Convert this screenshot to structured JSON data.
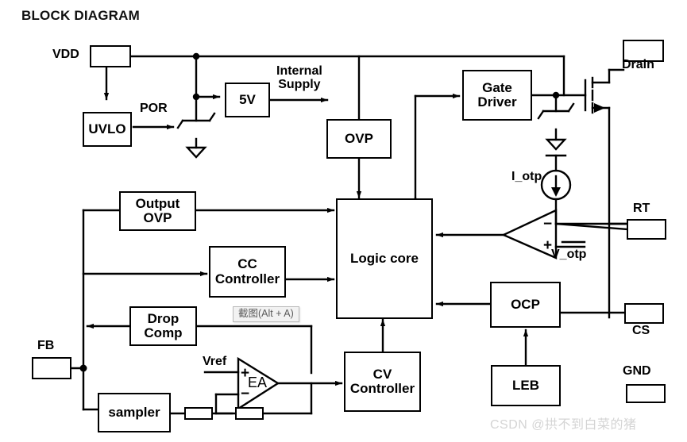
{
  "title": "BLOCK DIAGRAM",
  "blocks": [
    {
      "id": "uvlo",
      "label": "UVLO"
    },
    {
      "id": "reg5v",
      "label": "5V"
    },
    {
      "id": "ovp",
      "label": "OVP"
    },
    {
      "id": "gate_driver",
      "label": "Gate\nDriver"
    },
    {
      "id": "output_ovp",
      "label": "Output\nOVP"
    },
    {
      "id": "cc_ctrl",
      "label": "CC\nController"
    },
    {
      "id": "drop_comp",
      "label": "Drop\nComp"
    },
    {
      "id": "logic_core",
      "label": "Logic core"
    },
    {
      "id": "cv_ctrl",
      "label": "CV\nController"
    },
    {
      "id": "ocp",
      "label": "OCP"
    },
    {
      "id": "leb",
      "label": "LEB"
    },
    {
      "id": "sampler",
      "label": "sampler"
    }
  ],
  "pins": [
    {
      "id": "vdd",
      "label": "VDD"
    },
    {
      "id": "drain",
      "label": "Drain"
    },
    {
      "id": "rt",
      "label": "RT"
    },
    {
      "id": "cs",
      "label": "CS"
    },
    {
      "id": "gnd",
      "label": "GND"
    },
    {
      "id": "fb",
      "label": "FB"
    }
  ],
  "signals": [
    {
      "id": "por",
      "label": "POR"
    },
    {
      "id": "internal_supply",
      "label": "Internal\nSupply"
    },
    {
      "id": "i_otp",
      "label": "I_otp"
    },
    {
      "id": "v_otp",
      "label": "V_otp"
    },
    {
      "id": "vref",
      "label": "Vref"
    },
    {
      "id": "ea",
      "label": "EA"
    }
  ],
  "amplifier_signs": {
    "ea_plus": "+",
    "ea_minus": "−",
    "comp_minus": "−",
    "comp_plus": "+"
  },
  "tooltip": {
    "text": "截图(Alt + A)"
  },
  "watermark": {
    "text": "CSDN @拱不到白菜的猪"
  },
  "colors": {
    "line": "#000000",
    "background": "#ffffff",
    "tooltip_text": "#5a5a5a",
    "tooltip_bg": "#f2f2f2",
    "watermark": "#d4d4d4"
  }
}
